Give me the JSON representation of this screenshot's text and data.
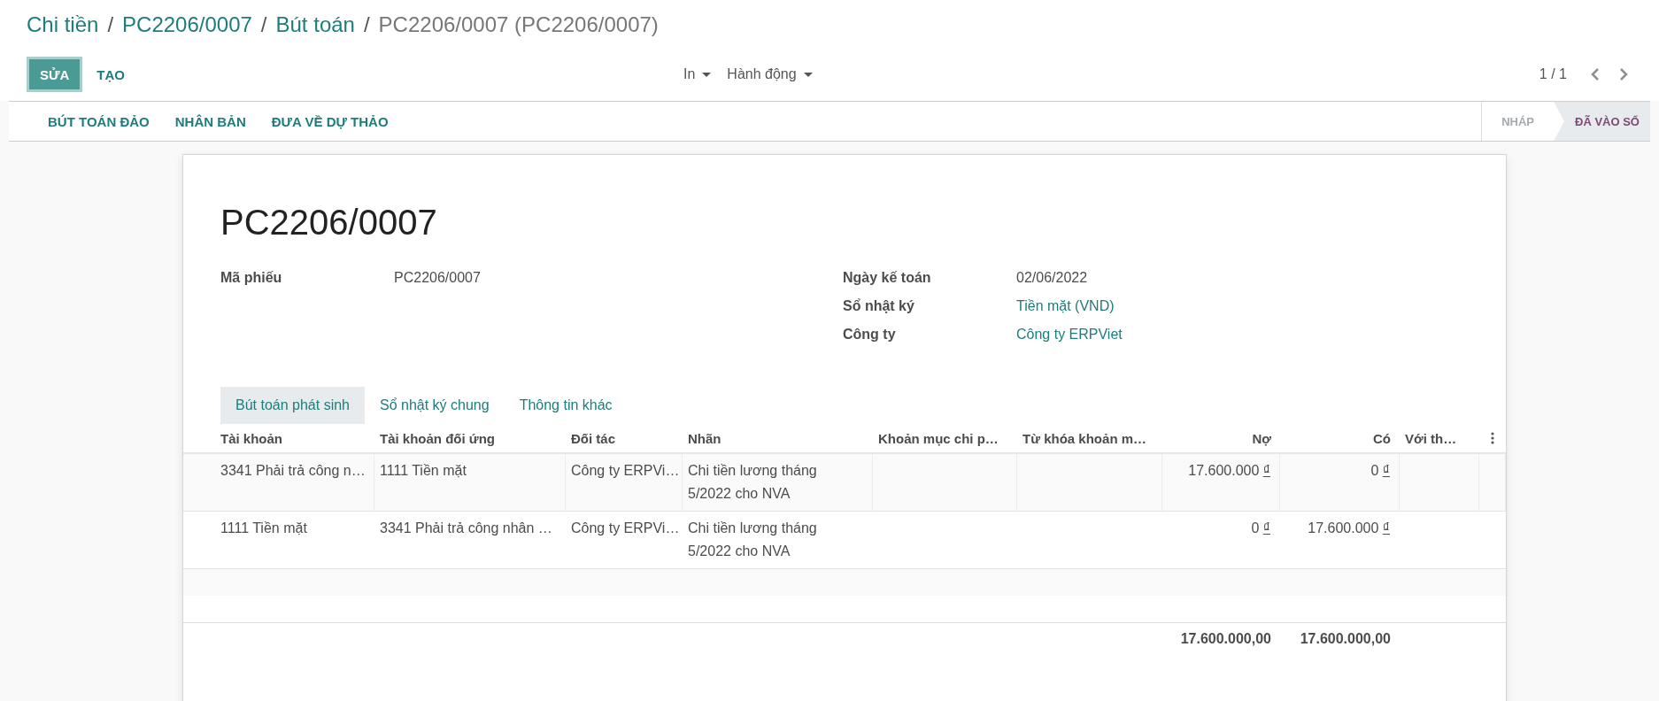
{
  "breadcrumb": [
    {
      "label": "Chi tiền",
      "current": false
    },
    {
      "label": "PC2206/0007",
      "current": false
    },
    {
      "label": "Bút toán",
      "current": false
    },
    {
      "label": "PC2206/0007 (PC2206/0007)",
      "current": true
    }
  ],
  "breadcrumb_separator": "/",
  "primary_buttons": [
    {
      "label": "SỬA",
      "kind": "primary"
    },
    {
      "label": "TẠO",
      "kind": "link"
    }
  ],
  "dropdowns": [
    "In",
    "Hành động"
  ],
  "pager": "1 / 1",
  "action_buttons": [
    "BÚT TOÁN ĐẢO",
    "NHÂN BẢN",
    "ĐƯA VỀ DỰ THẢO"
  ],
  "statuses": [
    {
      "label": "NHÁP",
      "selected": false
    },
    {
      "label": "ĐÃ VÀO SỔ",
      "selected": true
    }
  ],
  "title": "PC2206/0007",
  "left_fields": [
    {
      "label": "Mã phiếu",
      "value": "PC2206/0007",
      "link": false
    }
  ],
  "right_fields": [
    {
      "label": "Ngày kế toán",
      "value": "02/06/2022",
      "link": false
    },
    {
      "label": "Sổ nhật ký",
      "value": "Tiền mặt (VND)",
      "link": true
    },
    {
      "label": "Công ty",
      "value": "Công ty ERPViet",
      "link": true
    }
  ],
  "tabs": [
    {
      "label": "Bút toán phát sinh",
      "selected": true
    },
    {
      "label": "Sổ nhật ký chung",
      "selected": false
    },
    {
      "label": "Thông tin khác",
      "selected": false
    }
  ],
  "table": {
    "columns": [
      "Tài khoản",
      "Tài khoản đối ứng",
      "Đối tác",
      "Nhãn",
      "Khoản mục chi p…",
      "Từ khóa khoản m…",
      "Nợ",
      "Có",
      "Với th…"
    ],
    "rows": [
      {
        "account": "3341 Phải trả công n…",
        "counter_account": "1111 Tiền mặt",
        "partner": "Công ty ERPVi…",
        "label": "Chi tiền lương tháng 5/2022 cho NVA",
        "debit": "17.600.000",
        "credit": "0"
      },
      {
        "account": "1111 Tiền mặt",
        "counter_account": "3341 Phải trả công nhân …",
        "partner": "Công ty ERPVi…",
        "label": "Chi tiền lương tháng 5/2022 cho NVA",
        "debit": "0",
        "credit": "17.600.000"
      }
    ],
    "currency": "₫",
    "totals": {
      "debit": "17.600.000,00",
      "credit": "17.600.000,00"
    }
  }
}
